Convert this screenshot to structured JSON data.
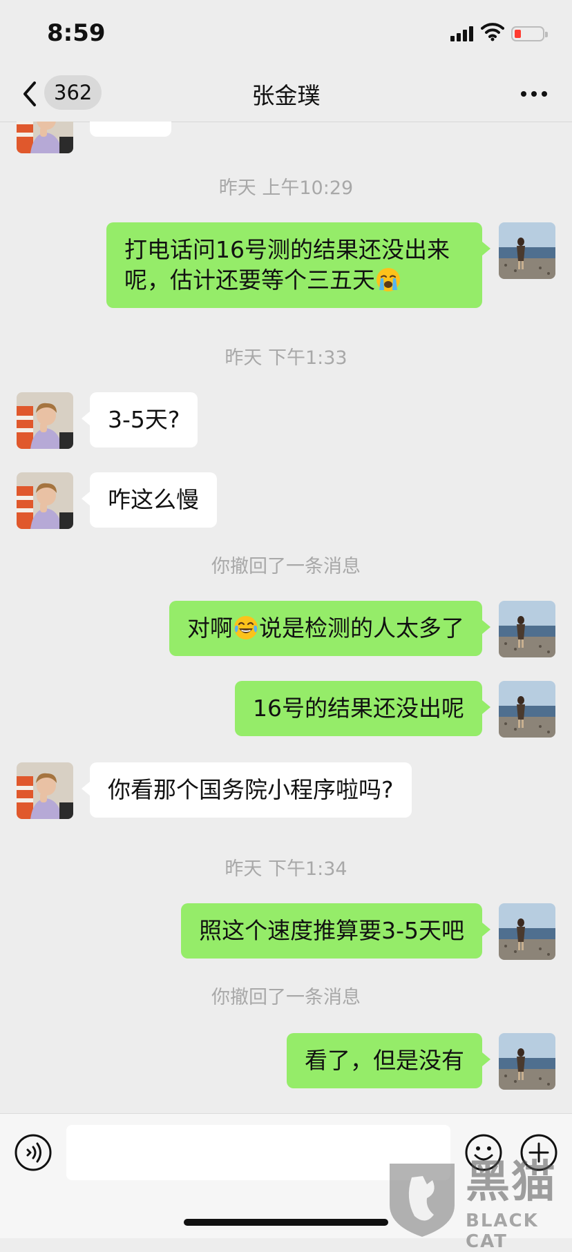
{
  "status_bar": {
    "time": "8:59"
  },
  "nav": {
    "unread_count": "362",
    "title": "张金璞"
  },
  "messages": [
    {
      "kind": "timestamp",
      "text": "昨天 上午10:29"
    },
    {
      "kind": "out",
      "text": "打电话问16号测的结果还没出来呢，估计还要等个三五天",
      "emoji": "loudly-crying-face"
    },
    {
      "kind": "timestamp",
      "text": "昨天 下午1:33"
    },
    {
      "kind": "in",
      "text": "3-5天?"
    },
    {
      "kind": "in",
      "text": "咋这么慢"
    },
    {
      "kind": "system",
      "text": "你撤回了一条消息"
    },
    {
      "kind": "out",
      "text_before": "对啊",
      "emoji": "face-with-tears-of-joy",
      "text_after": "说是检测的人太多了"
    },
    {
      "kind": "out",
      "text": "16号的结果还没出呢"
    },
    {
      "kind": "in",
      "text": "你看那个国务院小程序啦吗?"
    },
    {
      "kind": "timestamp",
      "text": "昨天 下午1:34"
    },
    {
      "kind": "out",
      "text": "照这个速度推算要3-5天吧"
    },
    {
      "kind": "system",
      "text": "你撤回了一条消息"
    },
    {
      "kind": "out",
      "text": "看了，但是没有"
    }
  ],
  "input_bar": {
    "text_value": "",
    "icons": [
      "voice-icon",
      "emoji-icon",
      "plus-icon"
    ]
  },
  "watermark": {
    "text": "黑猫",
    "sub": "BLACK CAT"
  },
  "colors": {
    "outgoing_bubble": "#95ec69",
    "incoming_bubble": "#ffffff",
    "background": "#ededed"
  }
}
